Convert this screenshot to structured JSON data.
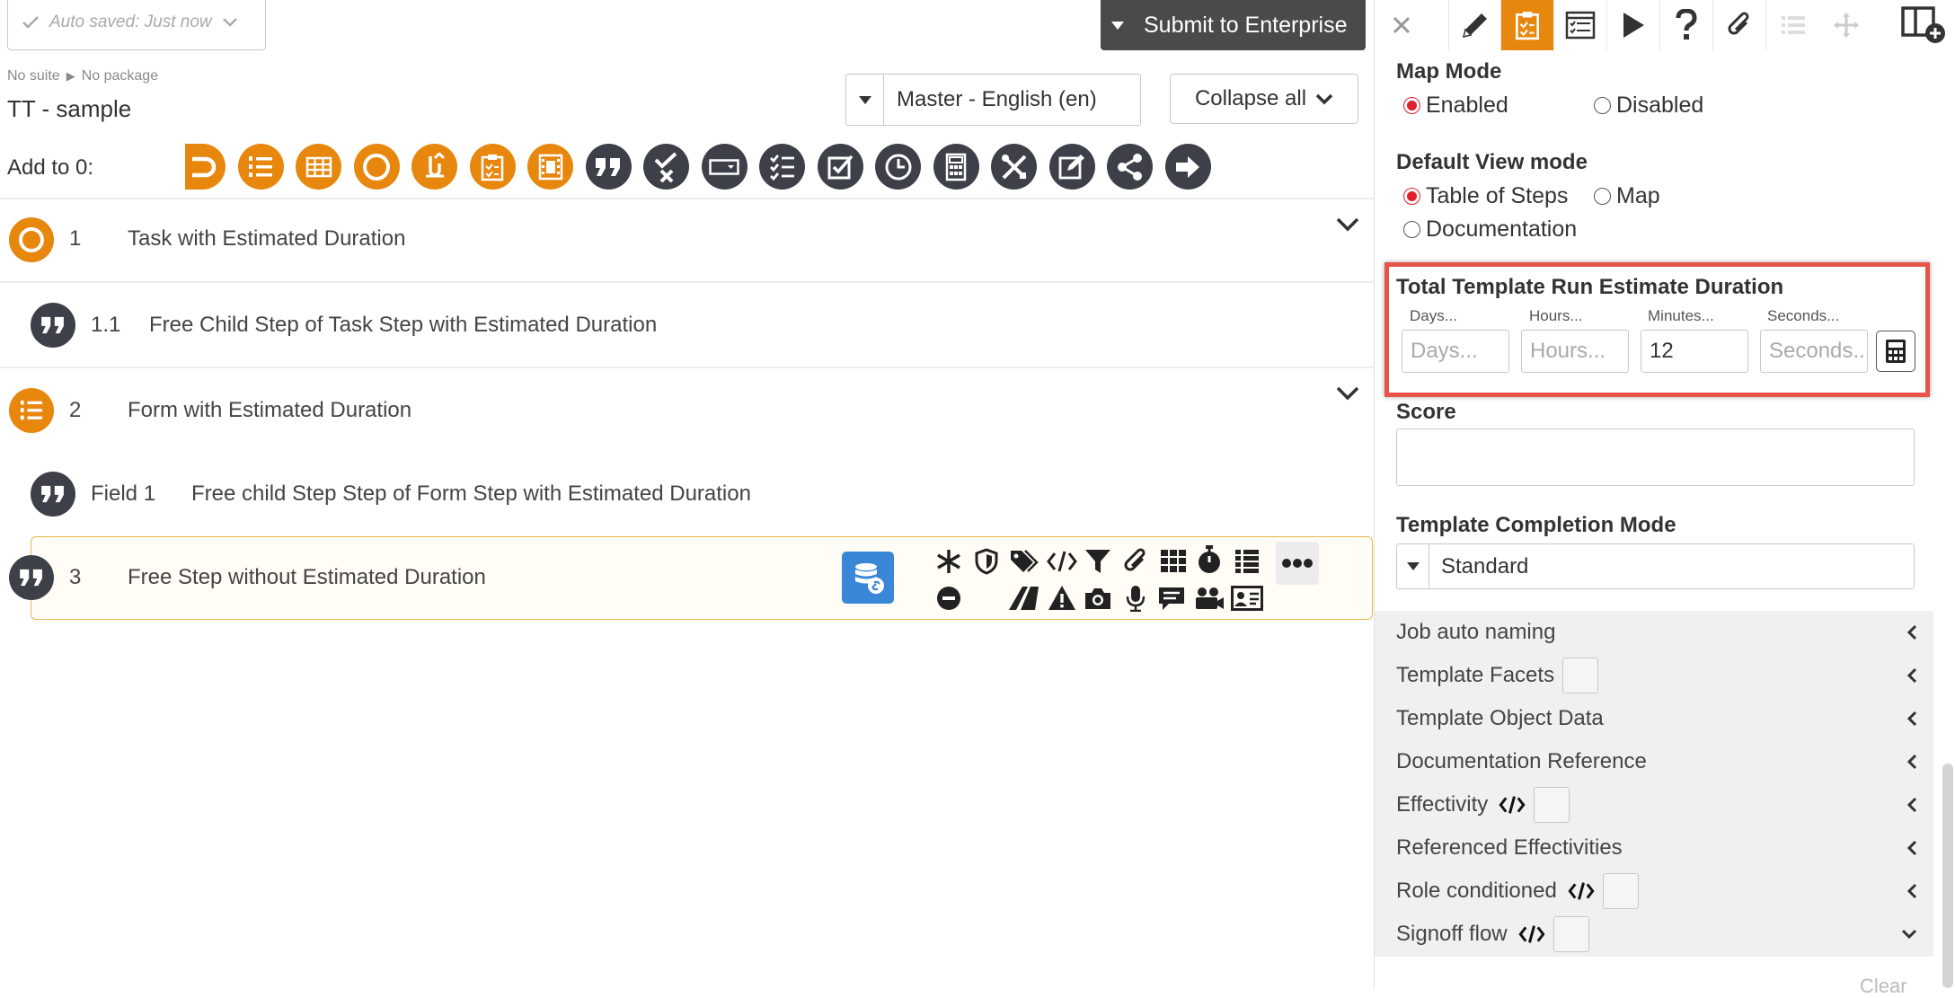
{
  "header": {
    "autosave_text": "Auto saved: Just now",
    "submit_label": "Submit to Enterprise"
  },
  "breadcrumb": {
    "suite": "No suite",
    "package": "No package"
  },
  "document": {
    "title": "TT - sample",
    "language": "Master - English (en)",
    "collapse_label": "Collapse all",
    "add_to_label": "Add to 0:"
  },
  "add_bar_icons": [
    {
      "icon": "loop-icon",
      "style": "orange"
    },
    {
      "icon": "numbered-list-icon",
      "style": "orange"
    },
    {
      "icon": "table-icon",
      "style": "orange"
    },
    {
      "icon": "circle-task-icon",
      "style": "orange"
    },
    {
      "icon": "link-icon",
      "style": "orange"
    },
    {
      "icon": "clipboard-check-icon",
      "style": "orange"
    },
    {
      "icon": "film-icon",
      "style": "orange"
    },
    {
      "icon": "quote-icon",
      "style": "dark"
    },
    {
      "icon": "check-cross-icon",
      "style": "dark"
    },
    {
      "icon": "dropdown-field-icon",
      "style": "dark"
    },
    {
      "icon": "checklist-icon",
      "style": "dark"
    },
    {
      "icon": "checkbox-icon",
      "style": "dark"
    },
    {
      "icon": "clock-icon",
      "style": "dark"
    },
    {
      "icon": "calculator-icon",
      "style": "dark"
    },
    {
      "icon": "tools-icon",
      "style": "dark"
    },
    {
      "icon": "edit-icon",
      "style": "dark"
    },
    {
      "icon": "share-icon",
      "style": "dark"
    },
    {
      "icon": "arrow-right-icon",
      "style": "dark"
    }
  ],
  "steps": [
    {
      "number": "1",
      "title": "Task with Estimated Duration"
    },
    {
      "number": "1.1",
      "title": "Free Child Step of Task Step with Estimated Duration"
    },
    {
      "number": "2",
      "title": "Form with Estimated Duration"
    },
    {
      "number": "Field 1",
      "title": "Free child Step Step of Form Step with Estimated Duration"
    },
    {
      "number": "3",
      "title": "Free Step without Estimated Duration"
    }
  ],
  "properties": {
    "map_mode": {
      "label": "Map Mode",
      "options": [
        "Enabled",
        "Disabled"
      ],
      "selected": "Enabled"
    },
    "default_view": {
      "label": "Default View mode",
      "options": [
        "Table of Steps",
        "Map",
        "Documentation"
      ],
      "selected": "Table of Steps"
    },
    "duration": {
      "label": "Total Template Run Estimate Duration",
      "days_label": "Days...",
      "hours_label": "Hours...",
      "minutes_label": "Minutes...",
      "seconds_label": "Seconds...",
      "days_placeholder": "Days...",
      "hours_placeholder": "Hours...",
      "minutes_value": "12",
      "seconds_placeholder": "Seconds..."
    },
    "score": {
      "label": "Score",
      "value": ""
    },
    "completion_mode": {
      "label": "Template Completion Mode",
      "value": "Standard"
    },
    "sections": [
      {
        "label": "Job auto naming"
      },
      {
        "label": "Template Facets"
      },
      {
        "label": "Template Object Data"
      },
      {
        "label": "Documentation Reference"
      },
      {
        "label": "Effectivity"
      },
      {
        "label": "Referenced Effectivities"
      },
      {
        "label": "Role conditioned"
      },
      {
        "label": "Signoff flow"
      }
    ],
    "clear_label": "Clear"
  },
  "colors": {
    "accent": "#e8870e",
    "dark_icon": "#3e4049",
    "highlight": "#e8544a",
    "step_selected_border": "#e7b64a",
    "db_icon": "#3a87d8",
    "radio_selected": "#e0202a"
  }
}
